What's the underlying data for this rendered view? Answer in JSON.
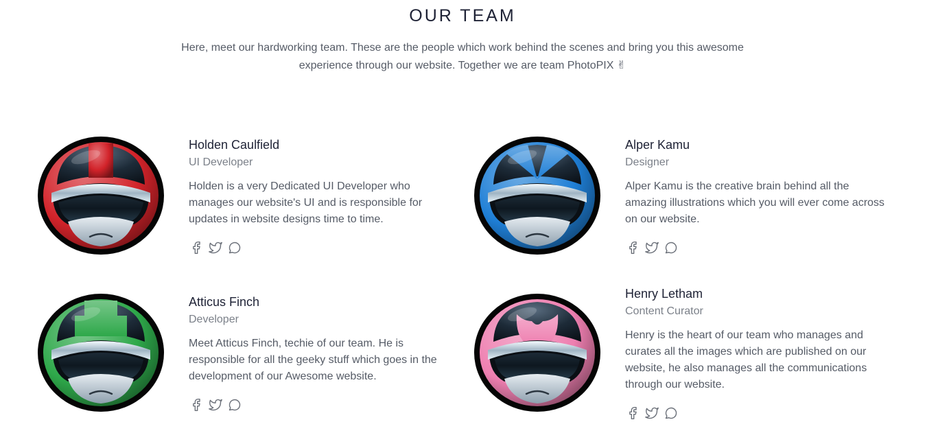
{
  "section": {
    "title": "OUR TEAM",
    "intro": "Here, meet our hardworking team. These are the people which work behind the scenes and bring you this awesome experience through our website. Together we are team PhotoPIX ✌"
  },
  "members": [
    {
      "name": "Holden Caulfield",
      "role": "UI Developer",
      "bio": "Holden is a very Dedicated UI Developer who manages our website's UI and is responsible for updates in website designs time to time.",
      "helmet_color": "#d2232a",
      "avatar_icon": "red-helmet-avatar"
    },
    {
      "name": "Alper Kamu",
      "role": "Designer",
      "bio": "Alper Kamu is the creative brain behind all the amazing illustrations which you will ever come across on our website.",
      "helmet_color": "#1f7fd6",
      "avatar_icon": "blue-helmet-avatar"
    },
    {
      "name": "Atticus Finch",
      "role": "Developer",
      "bio": "Meet Atticus Finch, techie of our team. He is responsible for all the geeky stuff which goes in the development of our Awesome website.",
      "helmet_color": "#2ea84a",
      "avatar_icon": "green-helmet-avatar"
    },
    {
      "name": "Henry Letham",
      "role": "Content Curator",
      "bio": "Henry is the heart of our team who manages and curates all the images which are published on our website, he also manages all the communications through our website.",
      "helmet_color": "#ee7fb0",
      "avatar_icon": "pink-helmet-avatar"
    }
  ],
  "social_icons": [
    "facebook-icon",
    "twitter-icon",
    "chat-icon"
  ],
  "colors": {
    "heading": "#1e2235",
    "body_text": "#555b66",
    "muted_text": "#7b8089",
    "icon": "#6c717a"
  }
}
